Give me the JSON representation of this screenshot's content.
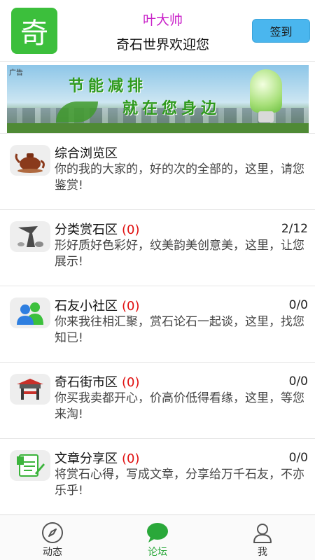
{
  "header": {
    "logo_char": "奇",
    "username": "叶大帅",
    "welcome": "奇石世界欢迎您",
    "checkin_label": "签到"
  },
  "banner": {
    "ad_tag": "广告",
    "line1": "节能减排",
    "line2": "就在您身边"
  },
  "forums": [
    {
      "title": "综合浏览区",
      "count": "",
      "stat": "",
      "desc": "你的我的大家的，好的次的全部的，这里，请您鉴赏!",
      "icon": "teapot-icon"
    },
    {
      "title": "分类赏石区",
      "count": "(0)",
      "stat": "2/12",
      "desc": "形好质好色彩好，纹美韵美创意美，这里，让您展示!",
      "icon": "stone-icon"
    },
    {
      "title": "石友小社区",
      "count": "(0)",
      "stat": "0/0",
      "desc": "你来我往相汇聚，赏石论石一起谈，这里，找您知已!",
      "icon": "people-icon"
    },
    {
      "title": "奇石街市区",
      "count": "(0)",
      "stat": "0/0",
      "desc": "你买我卖都开心，价高价低得看缘，这里，等您来淘!",
      "icon": "market-icon"
    },
    {
      "title": "文章分享区",
      "count": "(0)",
      "stat": "0/0",
      "desc": "将赏石心得，写成文章，分享给万千石友，不亦乐乎!",
      "icon": "article-icon"
    }
  ],
  "tabbar": {
    "tabs": [
      {
        "label": "动态",
        "icon": "compass-icon",
        "active": false
      },
      {
        "label": "论坛",
        "icon": "chat-bubble-icon",
        "active": true
      },
      {
        "label": "我",
        "icon": "user-icon",
        "active": false
      }
    ]
  },
  "colors": {
    "accent_green": "#2aa83a",
    "username_purple": "#c81ec8",
    "count_red": "#e01010",
    "checkin_blue": "#4ab6ee"
  }
}
